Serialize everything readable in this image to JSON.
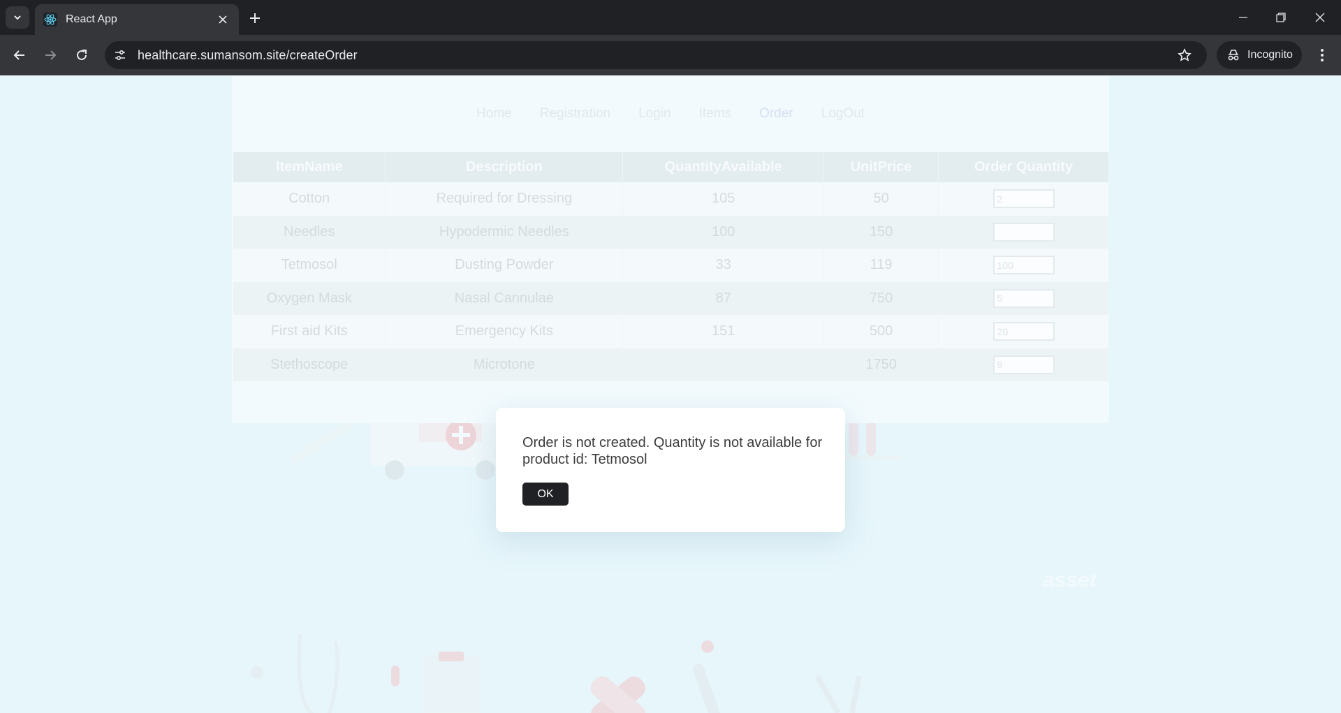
{
  "browser": {
    "tab_title": "React App",
    "url": "healthcare.sumansom.site/createOrder",
    "incognito_label": "Incognito"
  },
  "app": {
    "nav": [
      "Home",
      "Registration",
      "Login",
      "Items",
      "Order",
      "LogOut"
    ],
    "active_nav": "Order",
    "table": {
      "headers": [
        "ItemName",
        "Description",
        "QuantityAvailable",
        "UnitPrice",
        "Order Quantity"
      ],
      "rows": [
        {
          "name": "Cotton",
          "description": "Required for Dressing",
          "quantity": "105",
          "price": "50",
          "order_qty": "2"
        },
        {
          "name": "Needles",
          "description": "Hypodermic Needles",
          "quantity": "100",
          "price": "150",
          "order_qty": ""
        },
        {
          "name": "Tetmosol",
          "description": "Dusting Powder",
          "quantity": "33",
          "price": "119",
          "order_qty": "100"
        },
        {
          "name": "Oxygen Mask",
          "description": "Nasal Cannulae",
          "quantity": "87",
          "price": "750",
          "order_qty": "5"
        },
        {
          "name": "First aid Kits",
          "description": "Emergency Kits",
          "quantity": "151",
          "price": "500",
          "order_qty": "20"
        },
        {
          "name": "Stethoscope",
          "description": "Microtone",
          "quantity": "",
          "price": "1750",
          "order_qty": "9"
        }
      ]
    },
    "watermark": "asset"
  },
  "dialog": {
    "message": "Order is not created. Quantity is not available for product id: Tetmosol",
    "ok_label": "OK"
  },
  "colors": {
    "chrome_dark": "#202124",
    "chrome_mid": "#35363a",
    "page_bg": "#e6f6fb",
    "button_dark": "#202124"
  }
}
